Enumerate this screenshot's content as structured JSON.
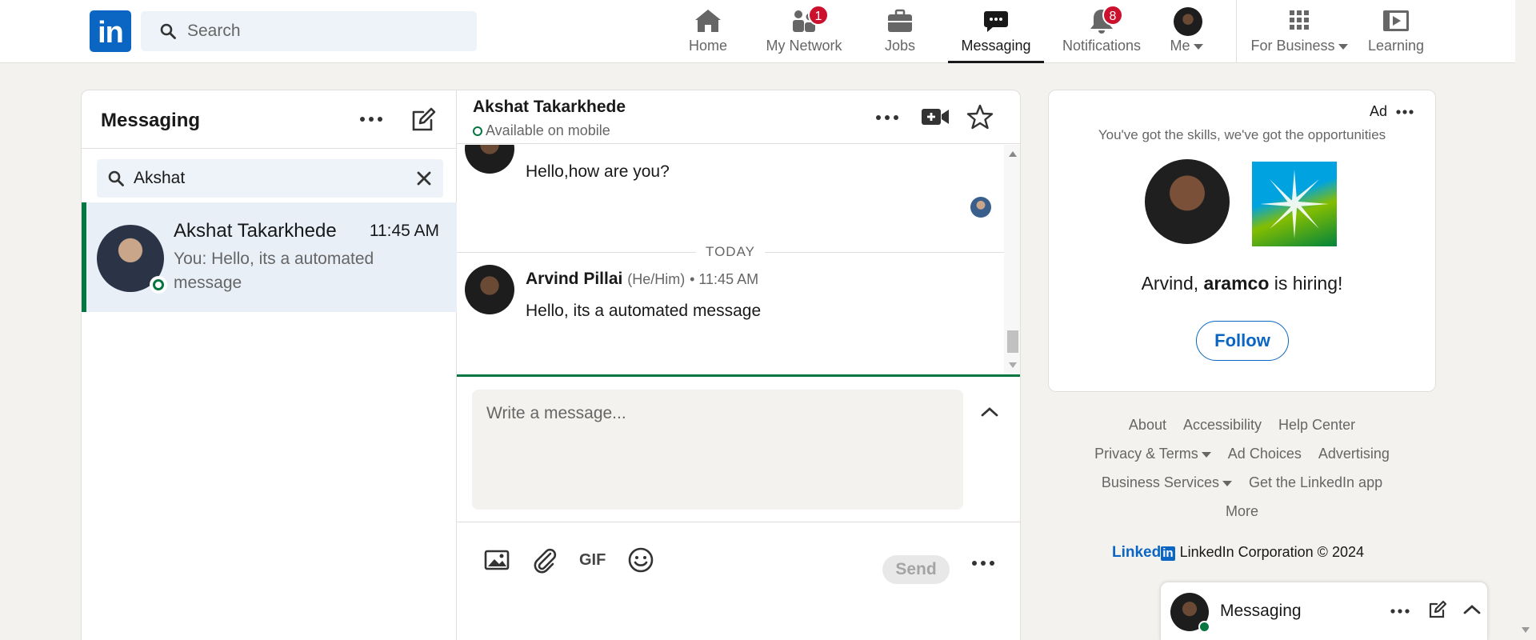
{
  "nav": {
    "logo_text": "in",
    "search_placeholder": "Search",
    "items": [
      {
        "label": "Home",
        "icon": "home-icon"
      },
      {
        "label": "My Network",
        "icon": "network-icon",
        "badge": "1"
      },
      {
        "label": "Jobs",
        "icon": "briefcase-icon"
      },
      {
        "label": "Messaging",
        "icon": "messaging-icon",
        "active": true
      },
      {
        "label": "Notifications",
        "icon": "bell-icon",
        "badge": "8"
      },
      {
        "label": "Me",
        "icon": "avatar"
      },
      {
        "label": "For Business",
        "icon": "grid-icon"
      },
      {
        "label": "Learning",
        "icon": "learning-icon"
      }
    ]
  },
  "messaging": {
    "title": "Messaging",
    "search_value": "Akshat",
    "conversation": {
      "name": "Akshat Takarkhede",
      "time": "11:45 AM",
      "snippet": "You: Hello, its a automated message"
    }
  },
  "chat": {
    "name": "Akshat Takarkhede",
    "status": "Available on mobile",
    "earlier_message": "Hello,how are you?",
    "day_separator": "TODAY",
    "sender_name": "Arvind Pillai",
    "sender_pronouns": "(He/Him)",
    "sender_time": "• 11:45 AM",
    "message": "Hello, its a automated message",
    "compose_placeholder": "Write a message...",
    "gif_label": "GIF",
    "send_label": "Send"
  },
  "ad": {
    "label": "Ad",
    "subtitle": "You've got the skills, we've got the opportunities",
    "hiring_prefix": "Arvind, ",
    "hiring_company": "aramco",
    "hiring_suffix": " is hiring!",
    "follow_label": "Follow"
  },
  "footer": {
    "links": [
      "About",
      "Accessibility",
      "Help Center",
      "Privacy & Terms",
      "Ad Choices",
      "Advertising",
      "Business Services",
      "Get the LinkedIn app",
      "More"
    ],
    "brand_word": "Linked",
    "brand_box": "in",
    "copyright": "LinkedIn Corporation © 2024"
  },
  "dock": {
    "title": "Messaging"
  },
  "colors": {
    "brand": "#0a66c2",
    "online": "#057642",
    "badge": "#cb112d",
    "background": "#f4f2ee"
  }
}
